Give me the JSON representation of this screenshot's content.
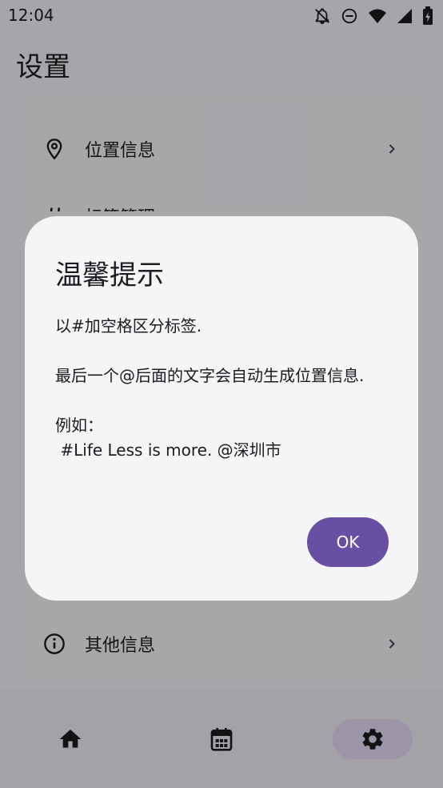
{
  "status_bar": {
    "time": "12:04",
    "icons": [
      "notifications-off-icon",
      "do-not-disturb-icon",
      "wifi-icon",
      "signal-icon",
      "battery-icon"
    ]
  },
  "page_title": "设置",
  "settings": {
    "items": [
      {
        "label": "位置信息",
        "icon": "location-pin-icon"
      },
      {
        "label": "标签管理",
        "icon": "hashtag-icon"
      },
      {
        "label": "其他信息",
        "icon": "info-icon"
      }
    ]
  },
  "bottom_nav": {
    "items": [
      "home-icon",
      "calendar-icon",
      "settings-icon"
    ],
    "active": "settings-icon"
  },
  "dialog": {
    "title": "温馨提示",
    "body": "以#加空格区分标签.\n\n最后一个@后面的文字会自动生成位置信息.\n\n例如：\n #Life Less is more. @深圳市",
    "ok_label": "OK"
  },
  "colors": {
    "primary": "#6750a4",
    "nav_active": "#e6dcf6",
    "scrim": "rgba(0,0,0,0.32)"
  }
}
